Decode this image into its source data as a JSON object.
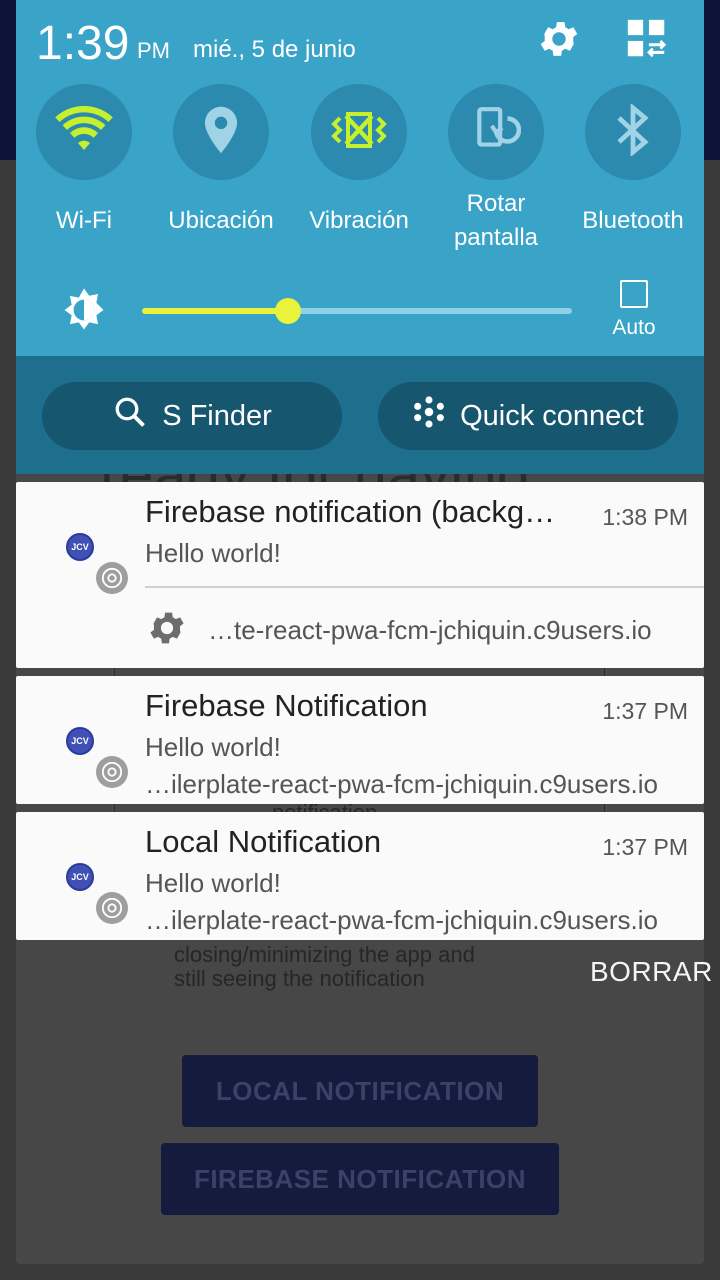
{
  "status": {
    "time": "1:39",
    "ampm": "PM",
    "date": "mié., 5 de junio"
  },
  "toggles": [
    {
      "label": "Wi-Fi",
      "icon": "wifi-icon",
      "active": true
    },
    {
      "label": "Ubicación",
      "icon": "location-icon",
      "active": false
    },
    {
      "label": "Vibración",
      "icon": "vibrate-icon",
      "active": true
    },
    {
      "label": "Rotar pantalla",
      "icon": "rotate-icon",
      "active": false
    },
    {
      "label": "Bluetooth",
      "icon": "bluetooth-icon",
      "active": false
    }
  ],
  "brightness": {
    "level": 0.34,
    "auto_label": "Auto",
    "auto_checked": false
  },
  "actions": {
    "s_finder": "S Finder",
    "quick_connect": "Quick connect"
  },
  "notifications": [
    {
      "title": "Firebase notification (backg…",
      "time": "1:38 PM",
      "text": "Hello world!",
      "action_text": "…te-react-pwa-fcm-jchiquin.c9users.io",
      "avatar": "JCV"
    },
    {
      "title": "Firebase Notification",
      "time": "1:37 PM",
      "text": "Hello world!",
      "url": "…ilerplate-react-pwa-fcm-jchiquin.c9users.io",
      "avatar": "JCV"
    },
    {
      "title": "Local Notification",
      "time": "1:37 PM",
      "text": "Hello world!",
      "url": "…ilerplate-react-pwa-fcm-jchiquin.c9users.io",
      "avatar": "JCV"
    }
  ],
  "clear_label": "BORRAR",
  "background_app": {
    "partial_heading": "ready for having",
    "partial_line": "notification",
    "desc_line1": "closing/minimizing the app and",
    "desc_line2": "still seeing the notification",
    "local_button": "LOCAL NOTIFICATION",
    "firebase_button": "FIREBASE NOTIFICATION"
  },
  "colors": {
    "panel": "#3aa3c8",
    "panel_lower": "#1d6f8d",
    "accent_active": "#c6ef2e",
    "brightness": "#eaf33b"
  }
}
